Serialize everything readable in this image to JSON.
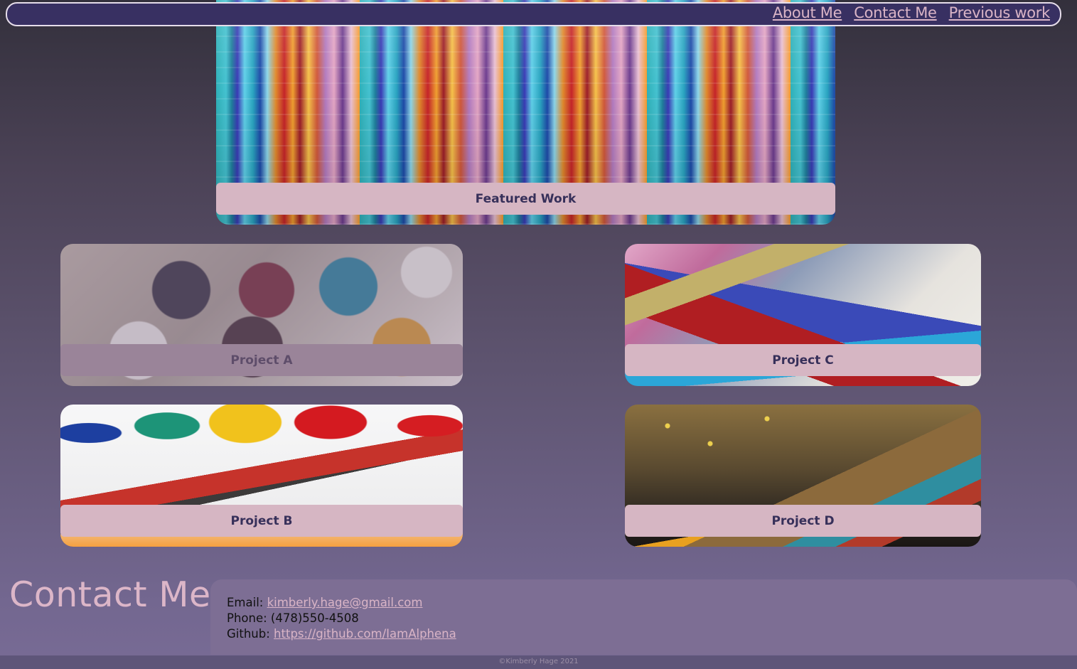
{
  "nav": {
    "links": [
      "About Me",
      "Contact Me",
      "Previous work"
    ]
  },
  "featured": {
    "label": "Featured Work"
  },
  "projects": {
    "a": "Project A",
    "b": "Project B",
    "c": "Project C",
    "d": "Project D"
  },
  "contact": {
    "heading": "Contact Me",
    "email_label": "Email:",
    "email": "kimberly.hage@gmail.com",
    "phone_label": "Phone:",
    "phone": "(478)550-4508",
    "github_label": "Github:",
    "github": "https://github.com/IamAlphena"
  },
  "footer": {
    "text": "©Kimberly Hage 2021"
  },
  "colors": {
    "nav_bg": "#383062",
    "link": "#d9b4c6",
    "card_label_bg": "#d6b6c3",
    "card_label_text": "#37305a"
  }
}
